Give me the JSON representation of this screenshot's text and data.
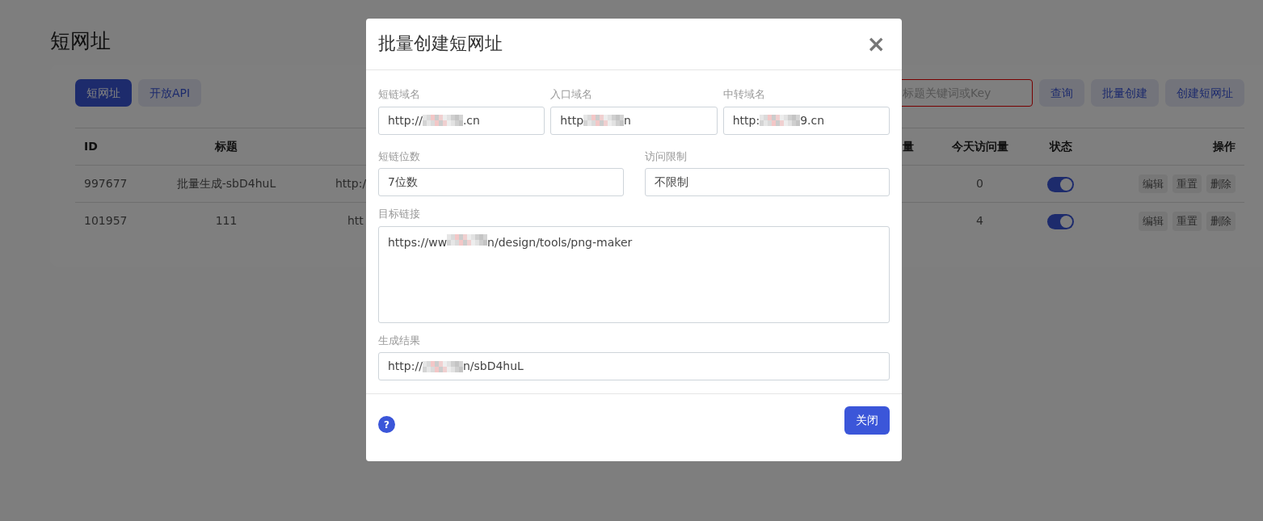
{
  "page_title": "短网址",
  "tabs": [
    {
      "label": "短网址",
      "selected": true
    },
    {
      "label": "开放API",
      "selected": false
    }
  ],
  "search": {
    "placeholder": "标题关键词或Key"
  },
  "toolbar_buttons": [
    "查询",
    "批量创建",
    "创建短网址"
  ],
  "table": {
    "columns": [
      {
        "label": "ID"
      },
      {
        "label": "标题"
      },
      {
        "label": "量"
      },
      {
        "label": "今天访问量"
      },
      {
        "label": "状态"
      },
      {
        "label": "操作"
      }
    ],
    "rows": [
      {
        "id": "997677",
        "title": "批量生成-sbD4huL",
        "link": "http:/",
        "today": "0",
        "enabled": true,
        "actions": [
          "编辑",
          "重置",
          "删除"
        ]
      },
      {
        "id": "101957",
        "title": "111",
        "link": "htt",
        "today": "4",
        "enabled": true,
        "actions": [
          "编辑",
          "重置",
          "删除"
        ]
      }
    ]
  },
  "modal": {
    "title": "批量创建短网址",
    "close": "×",
    "rows": [
      [
        {
          "label": "短链域名",
          "value_parts": [
            "http://",
            ".cn"
          ]
        },
        {
          "label": "入口域名",
          "value_parts": [
            "http",
            "n"
          ]
        },
        {
          "label": "中转域名",
          "value_parts": [
            "http:",
            "9.cn"
          ]
        }
      ],
      [
        {
          "label": "短链位数",
          "value_parts": [
            "7位数"
          ]
        },
        {
          "label": "访问限制",
          "value_parts": [
            "不限制"
          ]
        }
      ],
      [
        {
          "label": "目标链接",
          "kind": "textarea",
          "value_parts": [
            "https://ww",
            "n/design/tools/png-maker"
          ]
        }
      ],
      [
        {
          "label": "生成结果",
          "value_parts": [
            "http://",
            "n/sbD4huL"
          ]
        }
      ]
    ],
    "help": "?",
    "close_button": "关闭"
  }
}
